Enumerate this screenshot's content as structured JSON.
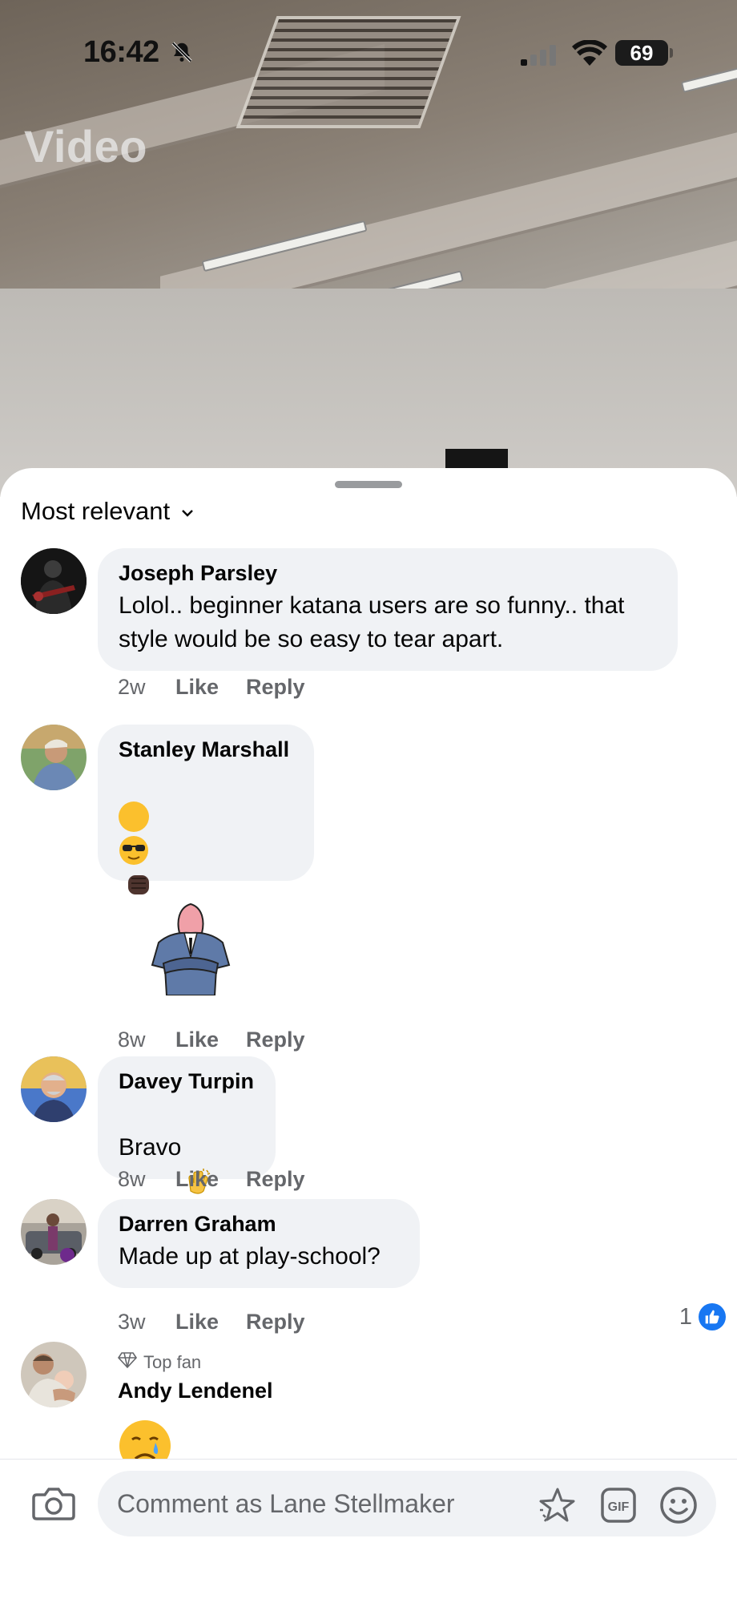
{
  "status_bar": {
    "time": "16:42",
    "battery": "69"
  },
  "video": {
    "title": "Video"
  },
  "sort": {
    "label": "Most relevant"
  },
  "comments": [
    {
      "author": "Joseph Parsley",
      "text": "Lolol.. beginner katana users are so funny.. that style would be so easy to tear apart.",
      "time": "2w",
      "like": "Like",
      "reply": "Reply"
    },
    {
      "author": "Stanley Marshall",
      "text": "",
      "time": "8w",
      "like": "Like",
      "reply": "Reply"
    },
    {
      "author": "Davey Turpin",
      "text": "Bravo",
      "time": "8w",
      "like": "Like",
      "reply": "Reply"
    },
    {
      "author": "Darren Graham",
      "text": "Made up at play-school?",
      "time": "3w",
      "like": "Like",
      "reply": "Reply",
      "reaction_count": "1"
    },
    {
      "author": "Andy Lendenel",
      "badge": "Top fan",
      "text": ""
    }
  ],
  "composer": {
    "placeholder": "Comment as Lane Stellmaker"
  },
  "colors": {
    "accent": "#1877f2",
    "bubble": "#f0f2f5",
    "meta": "#65676b"
  },
  "icons": [
    "bell-slash-icon",
    "signal-icon",
    "wifi-icon",
    "chevron-down-icon",
    "like-icon",
    "diamond-icon",
    "camera-icon",
    "sparkle-star-icon",
    "gif-icon",
    "emoji-icon"
  ]
}
